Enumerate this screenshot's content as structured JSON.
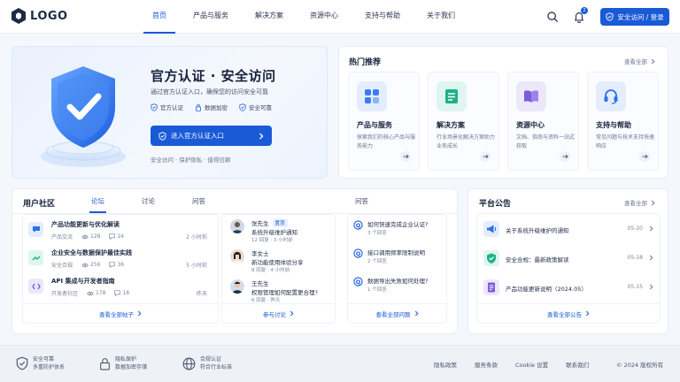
{
  "header": {
    "logo": "LOGO",
    "nav": [
      "首页",
      "产品与服务",
      "解决方案",
      "资源中心",
      "支持与帮助",
      "关于我们"
    ],
    "bell_badge": "2",
    "login_label": "安全访问 / 登录"
  },
  "hero": {
    "title": "官方认证 · 安全访问",
    "subtitle": "通过官方认证入口，确保您的访问安全可靠",
    "features": [
      "官方认证",
      "数据加密",
      "安全可靠"
    ],
    "button": "进入官方认证入口",
    "note": "安全访问 · 保护隐私 · 值得信赖"
  },
  "hot": {
    "title": "热门推荐",
    "view_all": "查看全部",
    "cards": [
      {
        "name": "产品与服务",
        "desc": "探索我们的核心产品与服务能力"
      },
      {
        "name": "解决方案",
        "desc": "行业场景化解决方案助力业务成长"
      },
      {
        "name": "资源中心",
        "desc": "文档、指南与资料一站式获取"
      },
      {
        "name": "支持与帮助",
        "desc": "常见问题与技术支持快速响应"
      }
    ]
  },
  "community": {
    "title": "用户社区",
    "tabs": [
      "论坛",
      "讨论",
      "问答"
    ],
    "tab_right": "问答",
    "posts": [
      {
        "title": "产品功能更新与优化解读",
        "category": "产品交流",
        "views": "128",
        "comments": "24",
        "time": "2 小时前"
      },
      {
        "title": "企业安全与数据保护最佳实践",
        "category": "安全合规",
        "views": "256",
        "comments": "36",
        "time": "5 小时前"
      },
      {
        "title": "API 集成与开发者指南",
        "category": "开发者社区",
        "views": "178",
        "comments": "18",
        "time": "昨天"
      }
    ],
    "posts_footer": "查看全部帖子",
    "discussions": [
      {
        "name": "张先生",
        "tag": "置顶",
        "text": "系统升级维护通知",
        "meta": "12 回复 · 3 小时前"
      },
      {
        "name": "李女士",
        "tag": "",
        "text": "新功能使用体验分享",
        "meta": "8 回复 · 4 小时前"
      },
      {
        "name": "王先生",
        "tag": "",
        "text": "权限管理如何配置更合理?",
        "meta": "6 回复 · 昨天"
      }
    ],
    "discussions_footer": "参与讨论",
    "questions": [
      {
        "text": "如何快速完成企业认证?",
        "meta": "3 个回答"
      },
      {
        "text": "接口调用频率限制说明",
        "meta": "2 个回答"
      },
      {
        "text": "数据导出失败如何处理?",
        "meta": "1 个回答"
      }
    ],
    "questions_footer": "查看全部问题"
  },
  "announce": {
    "title": "平台公告",
    "view_all": "查看全部",
    "items": [
      {
        "text": "关于系统升级维护的通知",
        "date": "05-20"
      },
      {
        "text": "安全合规：最新政策解读",
        "date": "05-18"
      },
      {
        "text": "产品功能更新说明（2024.05）",
        "date": "05-15"
      }
    ],
    "footer": "查看全部公告"
  },
  "footer": {
    "features": [
      {
        "line1": "安全可靠",
        "line2": "多重防护体系"
      },
      {
        "line1": "隐私保护",
        "line2": "数据加密存储"
      },
      {
        "line1": "合规认证",
        "line2": "符合行业标准"
      }
    ],
    "links": [
      "隐私政策",
      "服务条款",
      "Cookie 设置",
      "联系我们"
    ],
    "copyright": "© 2024 版权所有"
  },
  "colors": {
    "accent": "#1a5ad7",
    "background": "#f4f7fc"
  }
}
